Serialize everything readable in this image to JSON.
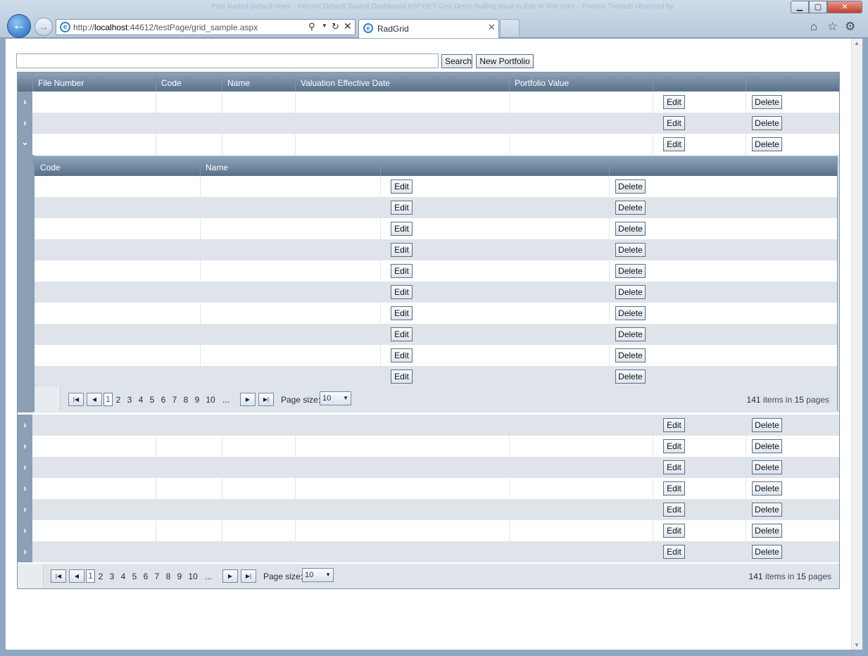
{
  "browser": {
    "url_host": "localhost",
    "url_rest": ":44612/testPage/grid_sample.aspx",
    "url_scheme": "http://",
    "tab_title": "RadGrid",
    "ghost_tabs": "Pets loaded   Default news - Internet   Default   Source Dashboard   ASP.NET Grid Demo   Bulling issue in Edit m   Text color - Forums   Threads observed by"
  },
  "toolbar": {
    "search_value": "",
    "search_label": "Search",
    "new_portfolio_label": "New Portfolio"
  },
  "grid": {
    "columns": [
      "File Number",
      "Code",
      "Name",
      "Valuation Effective Date",
      "Portfolio Value",
      "",
      ""
    ],
    "edit_label": "Edit",
    "delete_label": "Delete",
    "expand_glyph": "›",
    "collapse_glyph": "⌄",
    "detail": {
      "columns": [
        "Code",
        "Name",
        "",
        ""
      ],
      "row_count": 10
    }
  },
  "pager": {
    "pages": [
      "1",
      "2",
      "3",
      "4",
      "5",
      "6",
      "7",
      "8",
      "9",
      "10",
      "..."
    ],
    "current_page": "1",
    "page_size_label": "Page size:",
    "page_size": "10",
    "total_items": "141",
    "items_in": "items in",
    "total_pages": "15",
    "pages_word": "pages"
  }
}
